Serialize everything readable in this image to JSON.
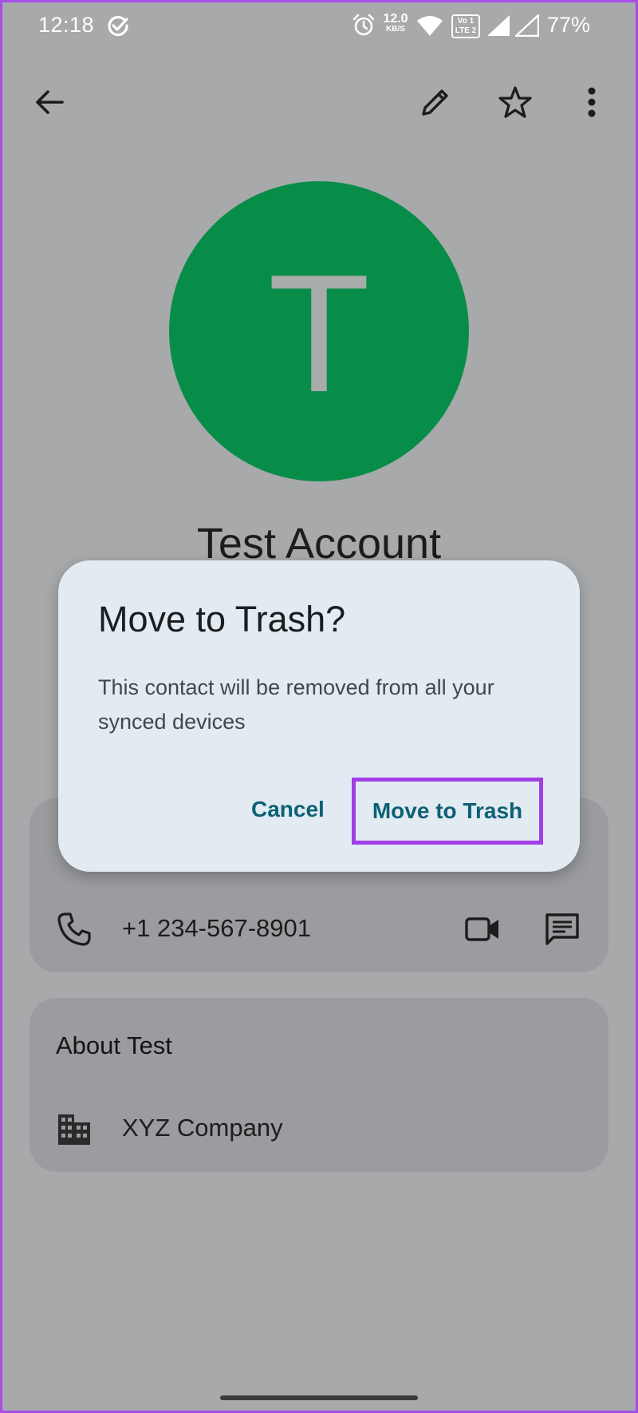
{
  "status_bar": {
    "time": "12:18",
    "net_speed_value": "12.0",
    "net_speed_unit": "KB/S",
    "volte_top": "Vo 1",
    "volte_bottom": "LTE 2",
    "battery": "77%"
  },
  "app_bar": {
    "icons": [
      "back-arrow-icon",
      "edit-pencil-icon",
      "star-icon",
      "more-vert-icon"
    ]
  },
  "contact": {
    "initial": "T",
    "name": "Test Account",
    "avatar_color": "#078d48"
  },
  "contact_card": {
    "phone": "+1 234-567-8901"
  },
  "about_card": {
    "title": "About Test",
    "company": "XYZ Company"
  },
  "dialog": {
    "title": "Move to Trash?",
    "body": "This contact will be removed from all your synced devices",
    "cancel_label": "Cancel",
    "confirm_label": "Move to Trash"
  },
  "colors": {
    "scrim_background": "#a8a9ab",
    "dialog_background": "#e1ebf1",
    "button_text": "#0d6075",
    "highlight_outline": "#a13ee6"
  }
}
